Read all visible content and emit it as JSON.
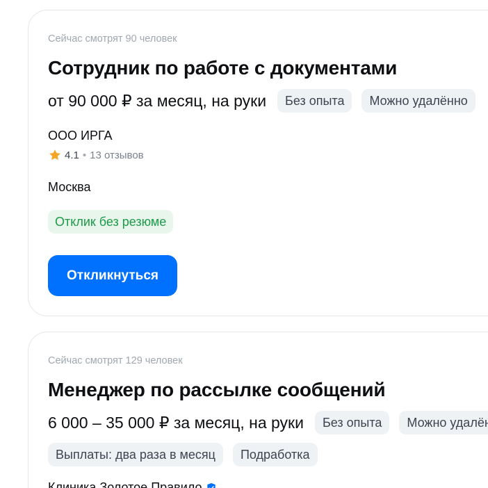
{
  "vacancies": [
    {
      "viewers": "Сейчас смотрят 90 человек",
      "title": "Сотрудник по работе с документами",
      "salary": "от 90 000 ₽ за месяц, на руки",
      "tags": [
        "Без опыта",
        "Можно удалённо"
      ],
      "company": "ООО ИРГА",
      "rating": {
        "value": "4.1",
        "separator": "•",
        "reviews": "13 отзывов"
      },
      "city": "Москва",
      "badge": "Отклик без резюме",
      "apply_label": "Откликнуться"
    },
    {
      "viewers": "Сейчас смотрят 129 человек",
      "title": "Менеджер по рассылке сообщений",
      "salary": "6 000 – 35 000 ₽ за месяц, на руки",
      "tags": [
        "Без опыта",
        "Можно удалённо"
      ],
      "extra_tags": [
        "Выплаты: два раза в месяц",
        "Подработка"
      ],
      "company": "Клиника Золотое Правило"
    }
  ],
  "colors": {
    "accent": "#0070ff",
    "badge_green_bg": "#e8f6ec",
    "badge_green_text": "#1e9a4a",
    "star": "#f5a623",
    "verified": "#0070ff"
  }
}
